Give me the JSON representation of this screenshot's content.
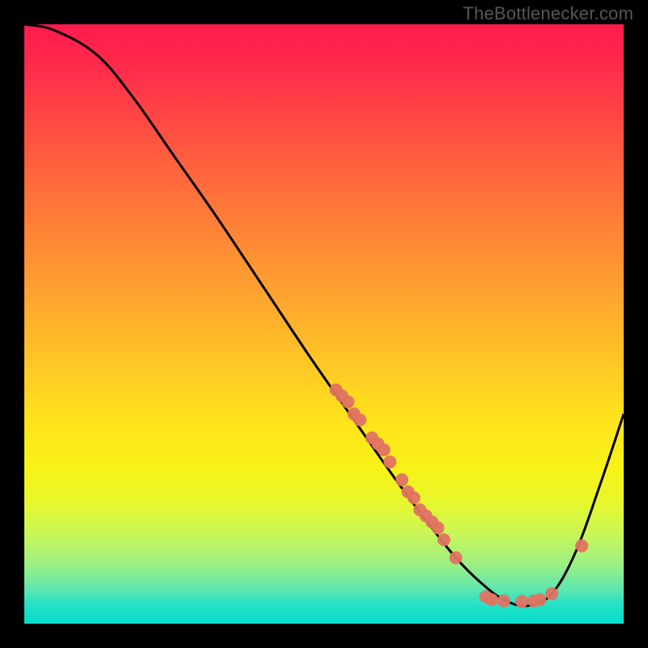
{
  "credit": "TheBottlenecker.com",
  "chart_data": {
    "type": "line",
    "title": "",
    "xlabel": "",
    "ylabel": "",
    "xlim": [
      0,
      100
    ],
    "ylim": [
      0,
      100
    ],
    "background_gradient": {
      "top": "#ff1a4f",
      "upper_mid": "#ff9a30",
      "mid": "#ffe020",
      "lower_mid": "#c0f050",
      "bottom": "#04dccb"
    },
    "curves": [
      {
        "name": "bottleneck-curve",
        "color": "#000000",
        "x": [
          0,
          5,
          12,
          18,
          25,
          32,
          40,
          48,
          55,
          62,
          68,
          72,
          76,
          80,
          84,
          88,
          92,
          96,
          100
        ],
        "y": [
          100,
          99,
          95,
          88,
          78,
          68,
          56,
          44,
          34,
          24,
          16,
          11,
          7,
          4,
          3,
          5,
          12,
          23,
          35
        ]
      }
    ],
    "minimum_region": {
      "x_start": 76,
      "x_end": 90,
      "y": 4
    },
    "marker_clusters": [
      {
        "name": "descending-markers",
        "color": "#e07362",
        "points": [
          {
            "x": 52,
            "y": 39
          },
          {
            "x": 53,
            "y": 38
          },
          {
            "x": 54,
            "y": 37
          },
          {
            "x": 55,
            "y": 35
          },
          {
            "x": 56,
            "y": 34
          },
          {
            "x": 58,
            "y": 31
          },
          {
            "x": 59,
            "y": 30
          },
          {
            "x": 60,
            "y": 29
          },
          {
            "x": 61,
            "y": 27
          },
          {
            "x": 63,
            "y": 24
          },
          {
            "x": 64,
            "y": 22
          },
          {
            "x": 65,
            "y": 21
          },
          {
            "x": 66,
            "y": 19
          },
          {
            "x": 67,
            "y": 18
          },
          {
            "x": 68,
            "y": 17
          },
          {
            "x": 69,
            "y": 16
          },
          {
            "x": 70,
            "y": 14
          },
          {
            "x": 72,
            "y": 11
          }
        ]
      },
      {
        "name": "bottom-markers",
        "color": "#e07362",
        "points": [
          {
            "x": 77,
            "y": 4.5
          },
          {
            "x": 78,
            "y": 4
          },
          {
            "x": 80,
            "y": 3.8
          },
          {
            "x": 83,
            "y": 3.7
          },
          {
            "x": 85,
            "y": 3.8
          },
          {
            "x": 86,
            "y": 4
          },
          {
            "x": 88,
            "y": 5
          }
        ]
      },
      {
        "name": "ascending-marker",
        "color": "#e07362",
        "points": [
          {
            "x": 93,
            "y": 13
          }
        ]
      }
    ]
  }
}
